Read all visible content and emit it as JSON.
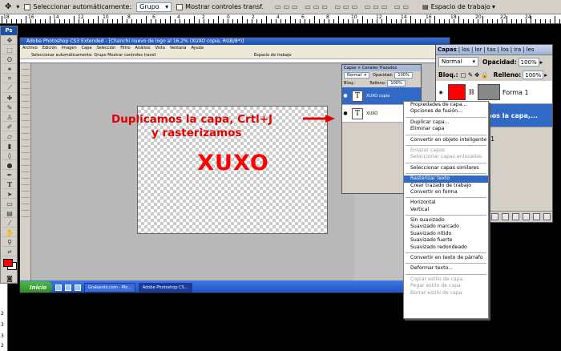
{
  "options_bar": {
    "auto_select_label": "Seleccionar automáticamente:",
    "auto_select_value": "Grupo",
    "transform_controls_label": "Mostrar controles transf.",
    "workspace_label": "Espacio de trabajo"
  },
  "toolbox": {
    "badge": "Ps"
  },
  "inner": {
    "title": "Adobe Photoshop CS3 Extended - [Chanchi nuevo de logo al 16,2% (XUXO copia, RGB/8*)]",
    "menu": [
      "Archivo",
      "Edición",
      "Imagen",
      "Capa",
      "Selección",
      "Filtro",
      "Análisis",
      "Vista",
      "Ventana",
      "Ayuda"
    ],
    "options_text": "Seleccionar automáticamente: Grupo   Mostrar controles transf.",
    "workspace": "Espacio de trabajo",
    "status": "Doc: 97,7 K/360,8 K",
    "taskbar": {
      "start": "Inicio",
      "tasks": [
        "Grabando.com - Mo...",
        "Adobe Photoshop CS..."
      ]
    },
    "layers_panel": {
      "tabs": "Capas × Canales  Trazados",
      "blend": "Normal",
      "opacity_label": "Opacidad:",
      "opacity": "100%",
      "lock_label": "Bloq.:",
      "fill_label": "Relleno:",
      "fill": "100%",
      "layers": [
        {
          "name": "XUXO copia",
          "selected": true
        },
        {
          "name": "XUXO",
          "selected": false
        }
      ]
    }
  },
  "canvas_text": "XUXO",
  "annotation": {
    "line1": "Duplicamos la capa, Crtl+J",
    "line2": "y rasterizamos"
  },
  "context_menu": {
    "items": [
      {
        "label": "Propiedades de capa...",
        "disabled": false
      },
      {
        "label": "Opciones de fusión...",
        "disabled": false
      },
      {
        "sep": true
      },
      {
        "label": "Duplicar capa...",
        "disabled": false
      },
      {
        "label": "Eliminar capa",
        "disabled": false
      },
      {
        "sep": true
      },
      {
        "label": "Convertir en objeto inteligente",
        "disabled": false
      },
      {
        "sep": true
      },
      {
        "label": "Enlazar capas",
        "disabled": true
      },
      {
        "label": "Seleccionar capas enlazadas",
        "disabled": true
      },
      {
        "sep": true
      },
      {
        "label": "Seleccionar capas similares",
        "disabled": false
      },
      {
        "sep": true
      },
      {
        "label": "Rasterizar texto",
        "disabled": false,
        "highlighted": true
      },
      {
        "label": "Crear trazado de trabajo",
        "disabled": false
      },
      {
        "label": "Convertir en forma",
        "disabled": false
      },
      {
        "sep": true
      },
      {
        "label": "Horizontal",
        "disabled": false
      },
      {
        "label": "Vertical",
        "disabled": false
      },
      {
        "sep": true
      },
      {
        "label": "Sin suavizado",
        "disabled": false
      },
      {
        "label": "Suavizado marcado",
        "disabled": false
      },
      {
        "label": "Suavizado nítido",
        "disabled": false
      },
      {
        "label": "Suavizado fuerte",
        "disabled": false
      },
      {
        "label": "Suavizado redondeado",
        "disabled": false
      },
      {
        "sep": true
      },
      {
        "label": "Convertir en texto de párrafo",
        "disabled": false
      },
      {
        "sep": true
      },
      {
        "label": "Deformar texto...",
        "disabled": false
      },
      {
        "sep": true
      },
      {
        "label": "Copiar estilo de capa",
        "disabled": true
      },
      {
        "label": "Pegar estilo de capa",
        "disabled": true
      },
      {
        "label": "Borrar estilo de capa",
        "disabled": true
      }
    ]
  },
  "right_panel": {
    "tabs": [
      "Capas",
      "los",
      "lor",
      "tas",
      "los",
      "ira",
      "les"
    ],
    "blend": "Normal",
    "opacity_label": "Opacidad:",
    "opacity": "100%",
    "lock_label": "Bloq.:",
    "fill_label": "Relleno:",
    "fill": "100%",
    "layers": [
      {
        "name": "Forma 1",
        "selected": false
      },
      {
        "name": "plicamos la capa,...",
        "selected": true
      },
      {
        "name": "1",
        "selected": false
      }
    ]
  },
  "ruler_numbers": [
    "18",
    "16",
    "14",
    "12",
    "10",
    "8",
    "6",
    "4",
    "2",
    "0",
    "2",
    "4",
    "6",
    "8",
    "10",
    "12",
    "14",
    "16",
    "18",
    "20",
    "22",
    "24"
  ],
  "left_strip_numbers": [
    "2",
    "3",
    "3",
    "2"
  ],
  "colors": {
    "accent": "#316ac5",
    "annotation": "#e30000",
    "canvas_text": "#ff0000"
  }
}
